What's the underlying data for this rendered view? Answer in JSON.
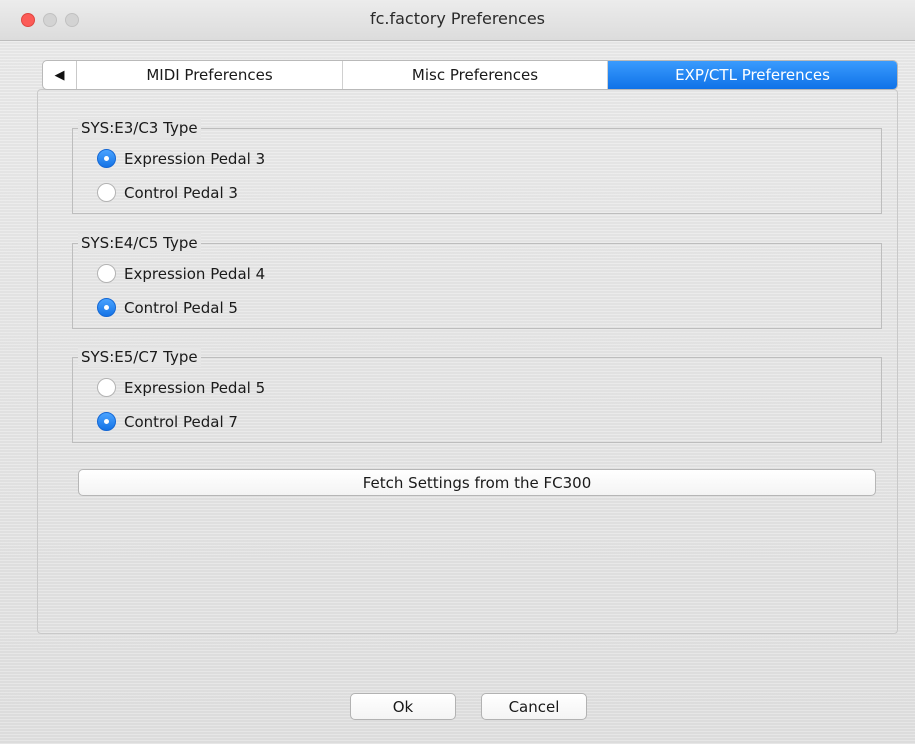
{
  "window": {
    "title": "fc.factory Preferences",
    "accent_color": "#1473e6",
    "close_button_color": "#fc5b57"
  },
  "tabs": {
    "scroll_icon": "◀",
    "items": [
      {
        "label": "MIDI Preferences",
        "selected": false
      },
      {
        "label": "Misc Preferences",
        "selected": false
      },
      {
        "label": "EXP/CTL Preferences",
        "selected": true
      }
    ]
  },
  "groups": [
    {
      "title": "SYS:E3/C3 Type",
      "options": [
        {
          "label": "Expression Pedal 3",
          "selected": true
        },
        {
          "label": "Control Pedal 3",
          "selected": false
        }
      ]
    },
    {
      "title": "SYS:E4/C5 Type",
      "options": [
        {
          "label": "Expression Pedal 4",
          "selected": false
        },
        {
          "label": "Control Pedal 5",
          "selected": true
        }
      ]
    },
    {
      "title": "SYS:E5/C7 Type",
      "options": [
        {
          "label": "Expression Pedal 5",
          "selected": false
        },
        {
          "label": "Control Pedal 7",
          "selected": true
        }
      ]
    }
  ],
  "fetch_button": {
    "label": "Fetch Settings from the FC300"
  },
  "dialog_buttons": {
    "ok": "Ok",
    "cancel": "Cancel"
  }
}
